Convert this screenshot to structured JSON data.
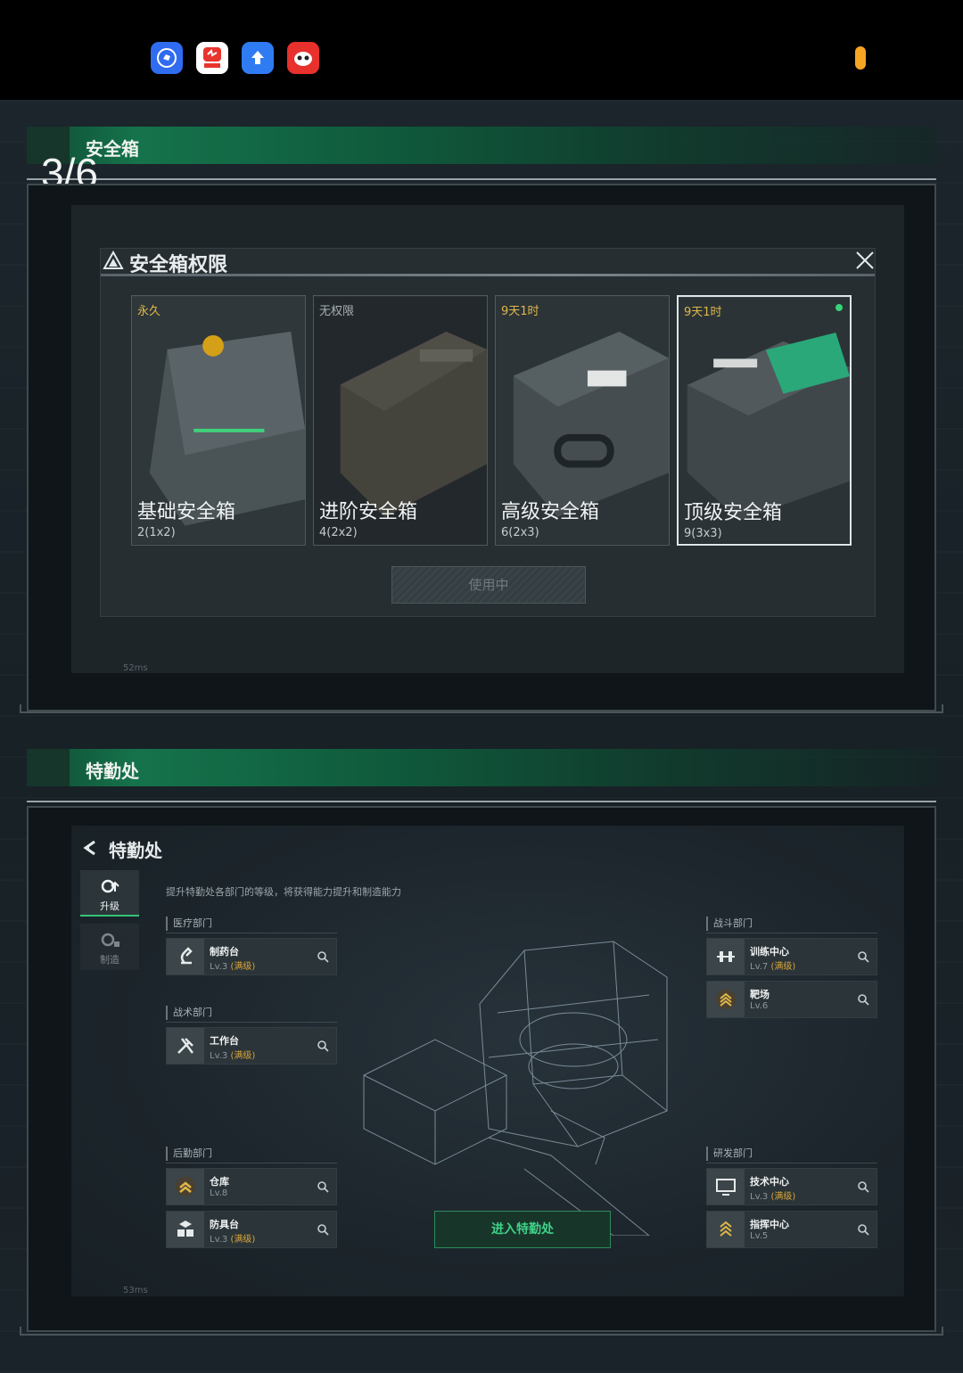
{
  "statusbar": {
    "apps": [
      {
        "icon": "hand-app-icon",
        "color": "#2f6cf0"
      },
      {
        "icon": "news-app-icon",
        "color": "#e8352e",
        "label": "资讯"
      },
      {
        "icon": "upload-app-icon",
        "color": "#2f7cf2"
      },
      {
        "icon": "game-app-icon",
        "color": "#e8302c"
      }
    ],
    "indicator_color": "#f5a623"
  },
  "page_counter": "3/6",
  "section1": {
    "header": "安全箱",
    "dialog": {
      "title": "安全箱权限",
      "cards": [
        {
          "tag": "永久",
          "name": "基础安全箱",
          "size": "2(1x2)",
          "selected": false
        },
        {
          "tag": "无权限",
          "name": "进阶安全箱",
          "size": "4(2x2)",
          "selected": false
        },
        {
          "tag": "9天1时",
          "name": "高级安全箱",
          "size": "6(2x3)",
          "selected": false
        },
        {
          "tag": "9天1时",
          "name": "顶级安全箱",
          "size": "9(3x3)",
          "selected": true
        }
      ],
      "use_button": "使用中"
    },
    "ping": "52ms"
  },
  "section2": {
    "header": "特勤处",
    "screen": {
      "title": "特勤处",
      "subtitle": "提升特勤处各部门的等级，将获得能力提升和制造能力",
      "tabs": [
        {
          "label": "升级",
          "active": true
        },
        {
          "label": "制造",
          "active": false
        }
      ],
      "departments": {
        "medical": {
          "label": "医疗部门",
          "items": [
            {
              "name": "制药台",
              "level": "Lv.3",
              "max": "(满级)"
            }
          ]
        },
        "tactical": {
          "label": "战术部门",
          "items": [
            {
              "name": "工作台",
              "level": "Lv.3",
              "max": "(满级)"
            }
          ]
        },
        "logistics": {
          "label": "后勤部门",
          "items": [
            {
              "name": "仓库",
              "level": "Lv.8",
              "max": ""
            },
            {
              "name": "防具台",
              "level": "Lv.3",
              "max": "(满级)"
            }
          ]
        },
        "combat": {
          "label": "战斗部门",
          "items": [
            {
              "name": "训练中心",
              "level": "Lv.7",
              "max": "(满级)"
            },
            {
              "name": "靶场",
              "level": "Lv.6",
              "max": ""
            }
          ]
        },
        "research": {
          "label": "研发部门",
          "items": [
            {
              "name": "技术中心",
              "level": "Lv.3",
              "max": "(满级)"
            },
            {
              "name": "指挥中心",
              "level": "Lv.5",
              "max": ""
            }
          ]
        }
      },
      "enter_button": "进入特勤处"
    },
    "ping": "53ms"
  }
}
